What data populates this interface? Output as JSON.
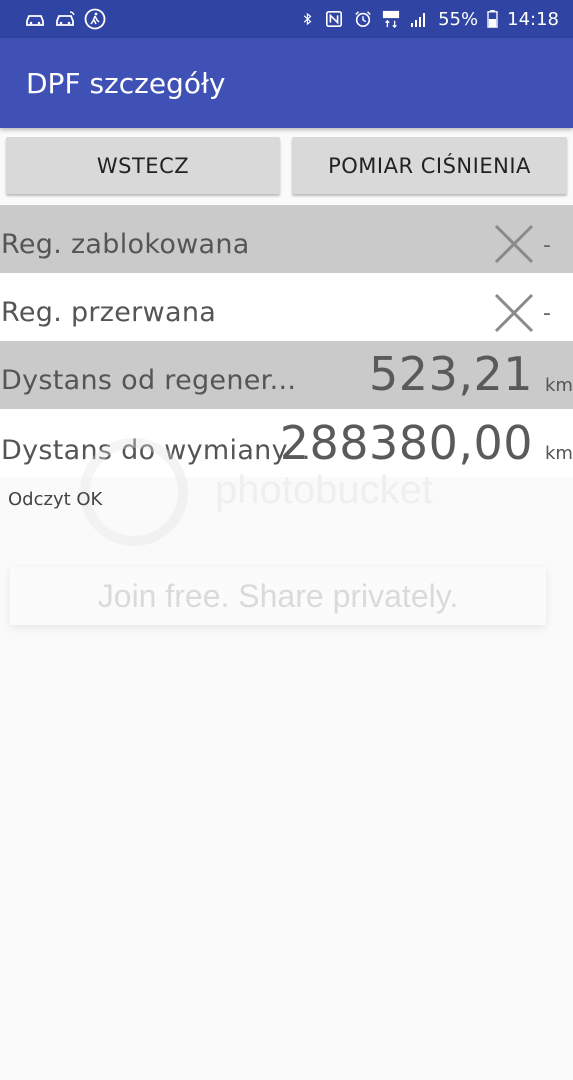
{
  "status_bar": {
    "battery": "55%",
    "time": "14:18",
    "left_icons": [
      "car-icon",
      "car-icon",
      "walking-icon"
    ],
    "right_icons": [
      "bluetooth-icon",
      "nfc-icon",
      "alarm-icon",
      "lte-icon",
      "signal-icon",
      "battery-icon"
    ]
  },
  "app_bar": {
    "title": "DPF szczegóły",
    "color": "#3f51b5"
  },
  "buttons": {
    "back": "WSTECZ",
    "pressure": "POMIAR CIŚNIENIA"
  },
  "rows": [
    {
      "label": "Reg. zablokowana",
      "icon": "close-icon",
      "value": "-"
    },
    {
      "label": "Reg. przerwana",
      "icon": "close-icon",
      "value": "-"
    },
    {
      "label": "Dystans od regener...",
      "value": "523,21",
      "unit": "km"
    },
    {
      "label": "Dystans do wymiany...",
      "value": "288380,00",
      "unit": "km"
    }
  ],
  "status_text": "Odczyt OK",
  "watermark": {
    "brand": "photobucket",
    "promo": "Join free. Share privately."
  }
}
